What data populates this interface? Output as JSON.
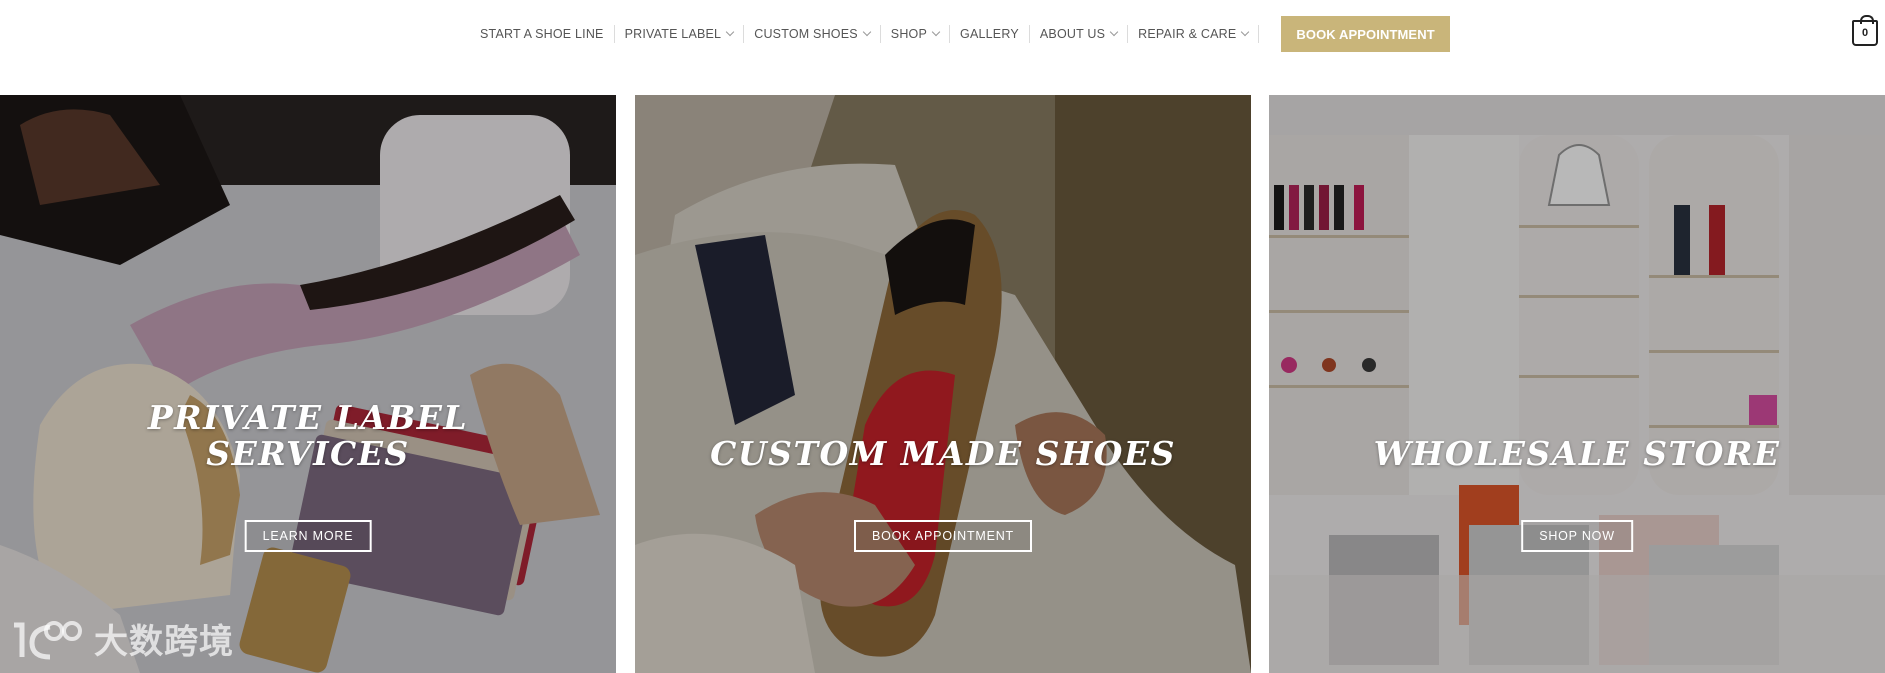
{
  "nav": {
    "items": [
      {
        "label": "START A SHOE LINE"
      },
      {
        "label": "PRIVATE LABEL"
      },
      {
        "label": "CUSTOM SHOES"
      },
      {
        "label": "SHOP"
      },
      {
        "label": "GALLERY"
      },
      {
        "label": "ABOUT US"
      },
      {
        "label": "REPAIR & CARE"
      }
    ],
    "book_label": "BOOK APPOINTMENT"
  },
  "cart": {
    "count": "0"
  },
  "panels": [
    {
      "title_line1": "PRIVATE LABEL",
      "title_line2": "SERVICES",
      "button": "LEARN MORE"
    },
    {
      "title": "CUSTOM MADE SHOES",
      "button": "BOOK APPOINTMENT"
    },
    {
      "title": "WHOLESALE STORE",
      "button": "SHOP NOW"
    }
  ],
  "watermark": {
    "text": "大数跨境"
  },
  "colors": {
    "accent": "#c9b57a",
    "nav_text": "#555555"
  }
}
